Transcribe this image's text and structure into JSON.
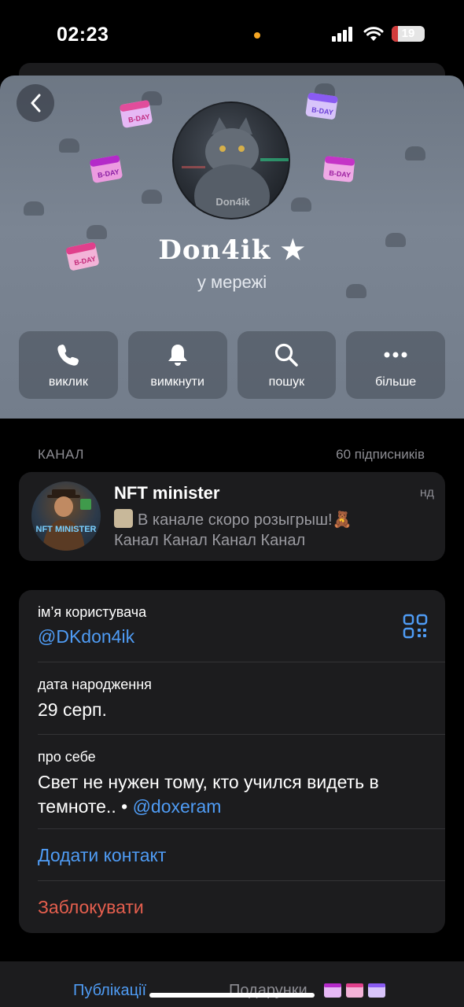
{
  "status_bar": {
    "time": "02:23",
    "battery": "19",
    "battery_level": 0.19
  },
  "profile": {
    "name": "Don4ik ★",
    "status": "у мережі",
    "avatar_text": "Don4ik"
  },
  "actions": [
    {
      "label": "виклик",
      "icon": "phone-icon"
    },
    {
      "label": "вимкнути",
      "icon": "bell-icon"
    },
    {
      "label": "пошук",
      "icon": "search-icon"
    },
    {
      "label": "більше",
      "icon": "more-icon"
    }
  ],
  "channel_section": {
    "title": "КАНАЛ",
    "subscribers": "60 підписників"
  },
  "channel": {
    "name": "NFT minister",
    "date": "нд",
    "message_line1": "В канале скоро розыгрыш!🧸",
    "message_line2": "Канал Канал Канал Канал",
    "avatar_text": "NFT MINISTER"
  },
  "info": {
    "username_label": "ім’я користувача",
    "username": "@DKdon4ik",
    "birthday_label": "дата народження",
    "birthday": "29 серп.",
    "bio_label": "про себе",
    "bio_line1": "Свет не нужен тому, кто учился видеть в",
    "bio_line2": "темноте.. • ",
    "bio_link": "@doxeram",
    "add_contact": "Додати контакт",
    "block": "Заблокувати"
  },
  "tabs": {
    "posts": "Публікації",
    "gifts": "Подарунки"
  },
  "colors": {
    "accent": "#4f9cf5",
    "danger": "#e65f4e",
    "header_bg": "#7b8593",
    "card_bg": "#1c1c1e"
  }
}
